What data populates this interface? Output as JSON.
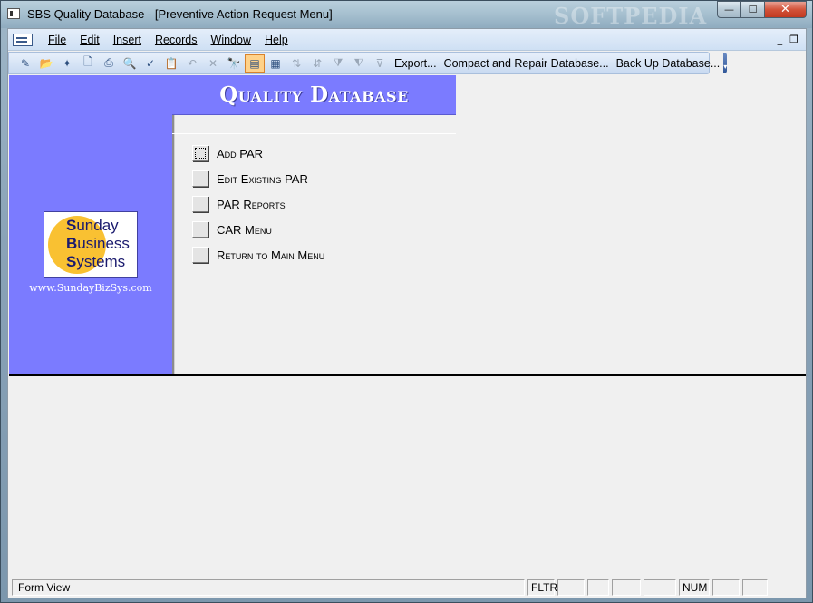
{
  "window": {
    "title": "SBS Quality Database - [Preventive Action Request Menu]",
    "watermark": "SOFTPEDIA",
    "minimize_glyph": "—",
    "maximize_glyph": "☐",
    "close_glyph": "✕"
  },
  "menubar": {
    "items": [
      {
        "label": "File"
      },
      {
        "label": "Edit"
      },
      {
        "label": "Insert"
      },
      {
        "label": "Records"
      },
      {
        "label": "Window"
      },
      {
        "label": "Help"
      }
    ],
    "mdi_minimize": "_",
    "mdi_restore": "❐"
  },
  "toolbar": {
    "icons": [
      {
        "name": "design-view-icon",
        "glyph": "✎",
        "state": "normal"
      },
      {
        "name": "open-icon",
        "glyph": "📂",
        "state": "normal"
      },
      {
        "name": "new-object-icon",
        "glyph": "✦",
        "state": "normal"
      },
      {
        "name": "file-search-icon",
        "glyph": "🗋",
        "state": "normal"
      },
      {
        "name": "print-icon",
        "glyph": "⎙",
        "state": "normal"
      },
      {
        "name": "print-preview-icon",
        "glyph": "🔍",
        "state": "normal"
      },
      {
        "name": "spelling-icon",
        "glyph": "✓",
        "state": "normal"
      },
      {
        "name": "paste-icon",
        "glyph": "📋",
        "state": "normal"
      },
      {
        "name": "undo-icon",
        "glyph": "↶",
        "state": "disabled"
      },
      {
        "name": "delete-icon",
        "glyph": "✕",
        "state": "disabled"
      },
      {
        "name": "find-icon",
        "glyph": "🔭",
        "state": "normal"
      },
      {
        "name": "form-view-icon",
        "glyph": "▤",
        "state": "active"
      },
      {
        "name": "datasheet-view-icon",
        "glyph": "▦",
        "state": "normal"
      },
      {
        "name": "sort-ascending-icon",
        "glyph": "⇅",
        "state": "disabled"
      },
      {
        "name": "sort-descending-icon",
        "glyph": "⇵",
        "state": "disabled"
      },
      {
        "name": "filter-by-selection-icon",
        "glyph": "⧩",
        "state": "disabled"
      },
      {
        "name": "filter-by-form-icon",
        "glyph": "⧨",
        "state": "disabled"
      },
      {
        "name": "apply-filter-icon",
        "glyph": "⊽",
        "state": "disabled"
      }
    ],
    "export_label": "Export...",
    "compact_label": "Compact and Repair Database...",
    "backup_label": "Back Up Database...",
    "overflow_glyph": "▾"
  },
  "form": {
    "title": "Quality Database",
    "logo": {
      "line1": "Sunday",
      "line2": "Business",
      "line3": "Systems"
    },
    "url": "www.SundayBizSys.com",
    "menu_items": [
      {
        "label": "Add PAR",
        "focused": true
      },
      {
        "label": "Edit Existing PAR",
        "focused": false
      },
      {
        "label": "PAR Reports",
        "focused": false
      },
      {
        "label": "CAR Menu",
        "focused": false
      },
      {
        "label": "Return to Main Menu",
        "focused": false
      }
    ]
  },
  "statusbar": {
    "view": "Form View",
    "fltr": "FLTR",
    "num": "NUM"
  },
  "colors": {
    "panel_blue": "#7b7bff",
    "logo_yellow": "#f9c132",
    "close_red": "#c23a20"
  }
}
